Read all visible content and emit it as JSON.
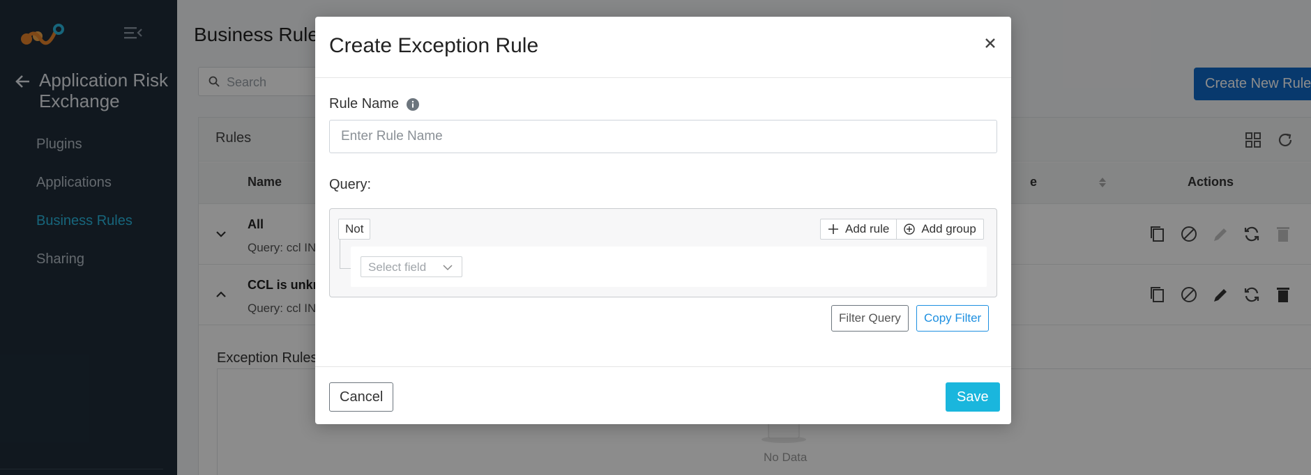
{
  "sidebar": {
    "logo_icon": "app-logo",
    "menu_icon": "menu-collapse-icon",
    "back_icon": "arrow-left-icon",
    "app_title": "Application Risk Exchange",
    "items": [
      {
        "label": "Plugins",
        "active": false
      },
      {
        "label": "Applications",
        "active": false
      },
      {
        "label": "Business Rules",
        "active": true
      },
      {
        "label": "Sharing",
        "active": false
      }
    ]
  },
  "page": {
    "title": "Business Rules",
    "search_placeholder": "Search",
    "create_button": "Create New Rule",
    "card_title": "Rules",
    "columns": {
      "name": "Name",
      "e_fragment": "e",
      "actions": "Actions"
    },
    "rows": [
      {
        "name": "All",
        "query": "Query: ccl IN",
        "expanded": false
      },
      {
        "name": "CCL is unkn",
        "query": "Query: ccl IN",
        "expanded": true
      }
    ],
    "exception_title": "Exception Rules",
    "no_data": "No Data"
  },
  "modal": {
    "title": "Create Exception Rule",
    "rule_name_label": "Rule Name",
    "rule_name_placeholder": "Enter Rule Name",
    "query_label": "Query:",
    "not_label": "Not",
    "add_rule_label": "Add rule",
    "add_group_label": "Add group",
    "select_field_placeholder": "Select field",
    "filter_query_label": "Filter Query",
    "copy_filter_label": "Copy Filter",
    "cancel_label": "Cancel",
    "save_label": "Save"
  },
  "colors": {
    "sidebar_bg": "#1f2d3a",
    "accent": "#2ab8e0",
    "primary_blue": "#0f69c7",
    "save_blue": "#1ab6dd"
  }
}
